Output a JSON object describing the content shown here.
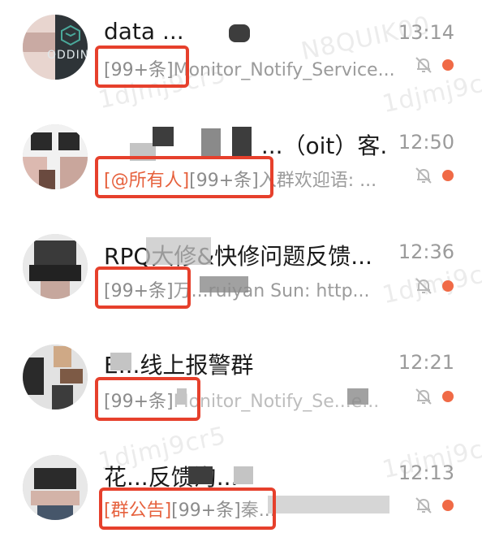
{
  "watermark": "1djmj9cr5",
  "watermark2": "N8QUIK00",
  "colors": {
    "accent": "#e6613d",
    "unread_dot": "#f06a46",
    "highlight_box": "#e6402c"
  },
  "chats": [
    {
      "title": "data ...",
      "time": "13:14",
      "at_tag": "",
      "count_tag": "[99+条]",
      "preview_rest": "Monitor_Notify_Service...",
      "avatar_text": "ODDIN",
      "muted": true,
      "unread": true
    },
    {
      "title": "...（oit）客...",
      "time": "12:50",
      "at_tag": "[@所有人]",
      "count_tag": "[99+条]",
      "preview_rest": "入群欢迎语: ...",
      "muted": true,
      "unread": true
    },
    {
      "title": "RPQ大修&快修问题反馈...",
      "time": "12:36",
      "at_tag": "",
      "count_tag": "[99+条]",
      "preview_rest": "万...ruiyan Sun: http...",
      "muted": true,
      "unread": true
    },
    {
      "title": "E...线上报警群",
      "time": "12:21",
      "at_tag": "",
      "count_tag": "[99+条]",
      "preview_rest": "Monitor_Notify_Se...e...",
      "muted": true,
      "unread": true
    },
    {
      "title": "花...反馈沟...",
      "time": "12:13",
      "at_tag": "[群公告]",
      "count_tag": "[99+条]",
      "preview_rest": "秦...",
      "muted": true,
      "unread": true
    }
  ]
}
